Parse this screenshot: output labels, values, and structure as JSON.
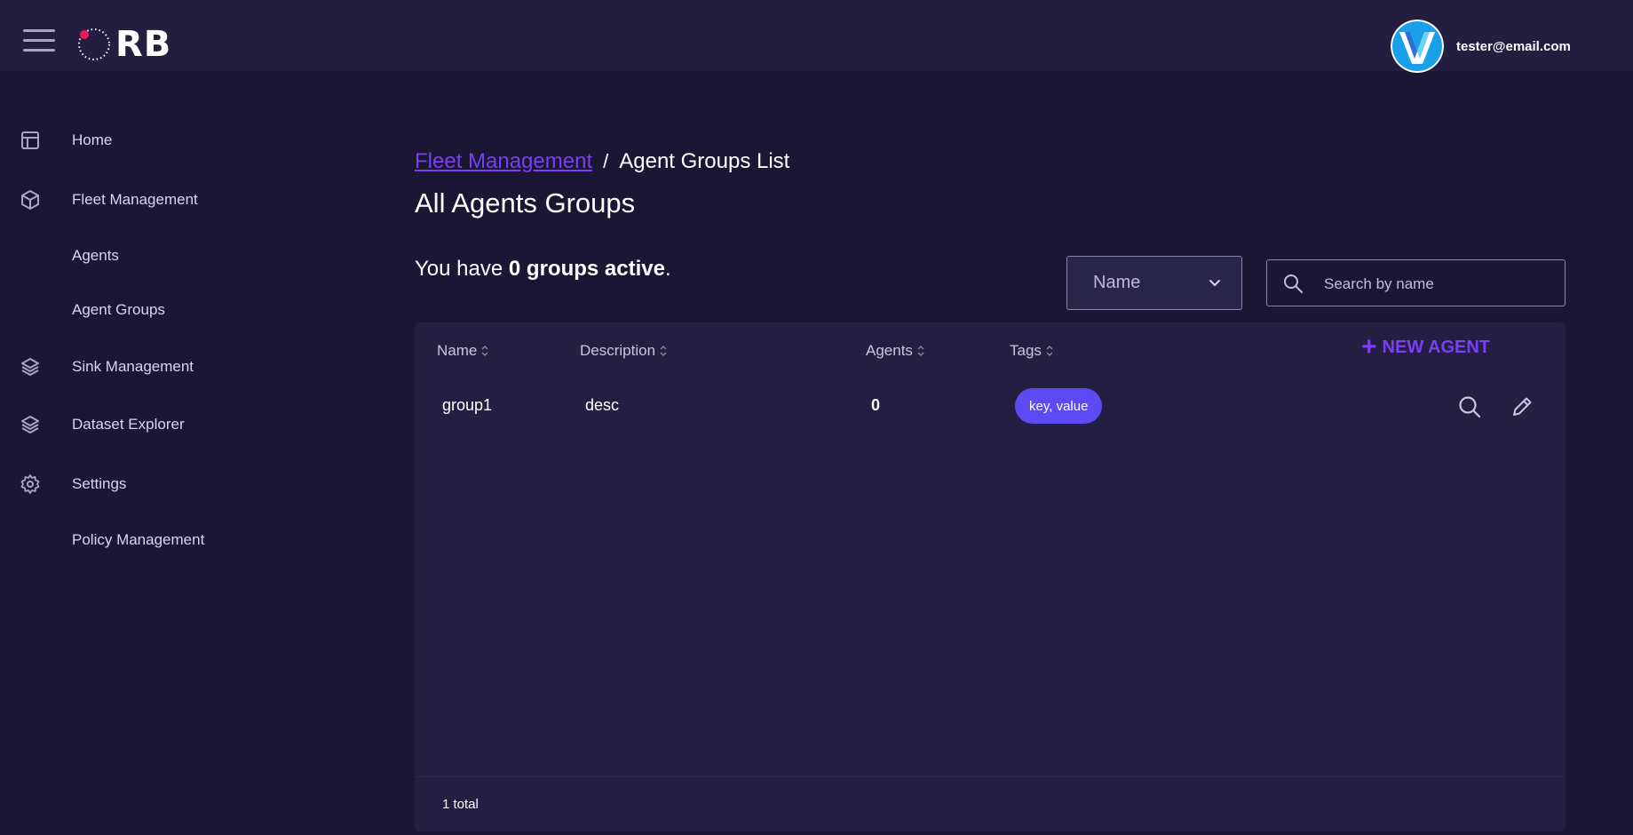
{
  "header": {
    "logo_text": "RB",
    "user_email": "tester@email.com"
  },
  "sidebar": {
    "items": [
      {
        "label": "Home",
        "icon": "layout-icon"
      },
      {
        "label": "Fleet Management",
        "icon": "cube-icon"
      },
      {
        "label": "Agents",
        "icon": ""
      },
      {
        "label": "Agent Groups",
        "icon": ""
      },
      {
        "label": "Sink Management",
        "icon": "layers-icon"
      },
      {
        "label": "Dataset Explorer",
        "icon": "layers-icon"
      },
      {
        "label": "Settings",
        "icon": "gear-icon"
      },
      {
        "label": "Policy Management",
        "icon": ""
      }
    ]
  },
  "breadcrumb": {
    "parent": "Fleet Management",
    "separator": "/",
    "current": "Agent Groups List"
  },
  "page": {
    "title": "All Agents Groups",
    "summary_prefix": "You have ",
    "summary_count": "0 groups active",
    "summary_suffix": "."
  },
  "filter": {
    "selected": "Name",
    "search_placeholder": "Search by name"
  },
  "table": {
    "columns": [
      "Name",
      "Description",
      "Agents",
      "Tags"
    ],
    "new_button": "NEW AGENT",
    "rows": [
      {
        "name": "group1",
        "description": "desc",
        "agents": "0",
        "tags": "key, value"
      }
    ],
    "footer": "1 total"
  },
  "colors": {
    "background": "#1b1633",
    "header": "#231e40",
    "card": "#241f42",
    "accent": "#7b3ff2",
    "tag": "#5c4af2"
  }
}
